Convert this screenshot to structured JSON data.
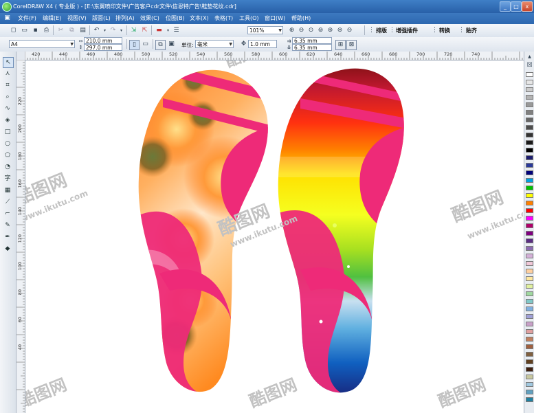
{
  "window": {
    "title": "CorelDRAW X4 ( 专业版 ) - [E:\\东翼喷印文件\\广告客户cdr文件\\信恩特广告\\鞋垫花纹.cdr]",
    "minimize": "_",
    "maximize": "□",
    "close": "x"
  },
  "menu": [
    "文件(F)",
    "编辑(E)",
    "视图(V)",
    "版面(L)",
    "排列(A)",
    "效果(C)",
    "位图(B)",
    "文本(X)",
    "表格(T)",
    "工具(O)",
    "窗口(W)",
    "帮助(H)"
  ],
  "toolbar": {
    "zoom": "101%",
    "plugins": [
      "排版",
      "增强插件",
      "转换",
      "贴齐"
    ]
  },
  "property_bar": {
    "page_size": "A4",
    "width": "210.0 mm",
    "height": "297.0 mm",
    "units_label": "单位:",
    "units_value": "毫米",
    "nudge": "1.0 mm",
    "dup_x": "6.35 mm",
    "dup_y": "6.35 mm"
  },
  "ruler": {
    "h_ticks": [
      "420",
      "440",
      "460",
      "480",
      "500",
      "520",
      "540",
      "560",
      "580",
      "600",
      "620",
      "640",
      "660",
      "680",
      "700",
      "720",
      "740"
    ],
    "v_ticks": [
      "220",
      "200",
      "180",
      "160",
      "140",
      "120",
      "100",
      "80",
      "60",
      "40"
    ]
  },
  "watermark": {
    "brand": "酷图网",
    "url": "www.ikutu.com"
  },
  "palette": {
    "colors": [
      "#ffffff",
      "#e6e6e6",
      "#cccccc",
      "#b3b3b3",
      "#999999",
      "#808080",
      "#666666",
      "#4d4d4d",
      "#333333",
      "#1a1a1a",
      "#000000",
      "#1c1c6e",
      "#2a3a9a",
      "#00007a",
      "#00a0e0",
      "#00c000",
      "#ffff00",
      "#ff8000",
      "#ff0000",
      "#ff00ff",
      "#b0006a",
      "#800080",
      "#5a2d82",
      "#8c6bb1",
      "#d4b0d8",
      "#f0c8d8",
      "#ffd0a0",
      "#ffe8a0",
      "#e0f0a0",
      "#a0d8a0",
      "#80c8c8",
      "#80b0e0",
      "#a0a0d8",
      "#c8a0c8",
      "#e0a0a0",
      "#c08060",
      "#a06040",
      "#806040",
      "#604020",
      "#402010",
      "#c8c8a0",
      "#a0c8e0",
      "#60a0c0",
      "#2080a0"
    ]
  }
}
